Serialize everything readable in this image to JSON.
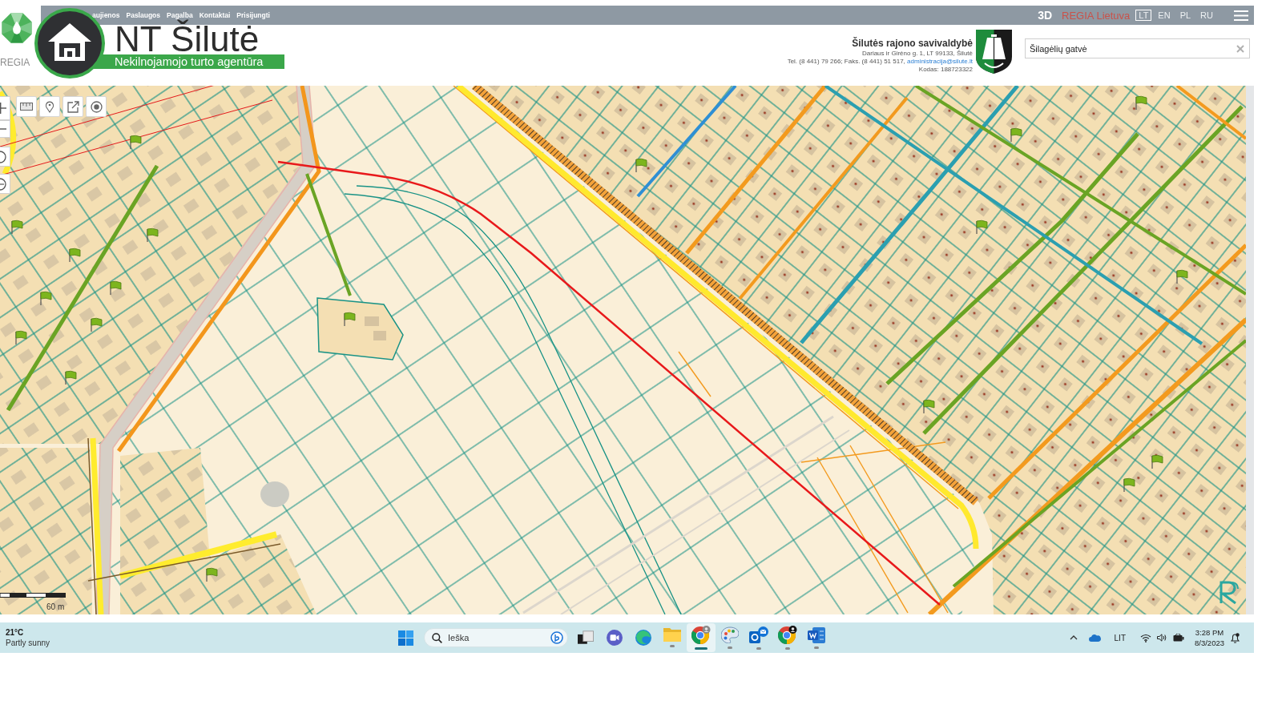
{
  "top_bar": {
    "logo_text": "REGIA",
    "nav_links": [
      "aujienos",
      "Paslaugos",
      "Pagalba",
      "Kontaktai",
      "Prisijungti"
    ],
    "view_toggle": "3D",
    "brand_link": "REGIA Lietuva",
    "languages": [
      {
        "label": "LT",
        "selected": true
      },
      {
        "label": "EN",
        "selected": false
      },
      {
        "label": "PL",
        "selected": false
      },
      {
        "label": "RU",
        "selected": false
      }
    ]
  },
  "site_logo": {
    "title": "NT Šilutė",
    "tagline": "Nekilnojamojo turto agentūra"
  },
  "municipality": {
    "name": "Šilutės rajono savivaldybė",
    "address": "Dariaus ir Girėno g. 1, LT 99133, Šilutė",
    "contacts": "Tel. (8 441) 79 266; Faks. (8 441) 51 517,",
    "email": "administracija@silute.lt",
    "code": "Kodas: 188723322"
  },
  "search": {
    "value": "Šilagėlių gatvė"
  },
  "map": {
    "scale_label": "60 m"
  },
  "taskbar": {
    "weather": {
      "temperature": "21°C",
      "condition": "Partly sunny"
    },
    "search": {
      "placeholder": "Ieška"
    },
    "apps": [
      {
        "kind": "task-view",
        "running": false,
        "selected": false
      },
      {
        "kind": "chat",
        "running": false,
        "selected": false
      },
      {
        "kind": "edge",
        "running": false,
        "selected": false
      },
      {
        "kind": "explorer",
        "running": true,
        "selected": false
      },
      {
        "kind": "chrome",
        "running": true,
        "selected": true
      },
      {
        "kind": "paint",
        "running": true,
        "selected": false
      },
      {
        "kind": "outlook",
        "running": true,
        "selected": false
      },
      {
        "kind": "chrome-profile",
        "running": true,
        "selected": false
      },
      {
        "kind": "word",
        "running": true,
        "selected": false
      }
    ],
    "tray": {
      "language": "LIT",
      "time": "3:28 PM",
      "date": "8/3/2023"
    }
  }
}
